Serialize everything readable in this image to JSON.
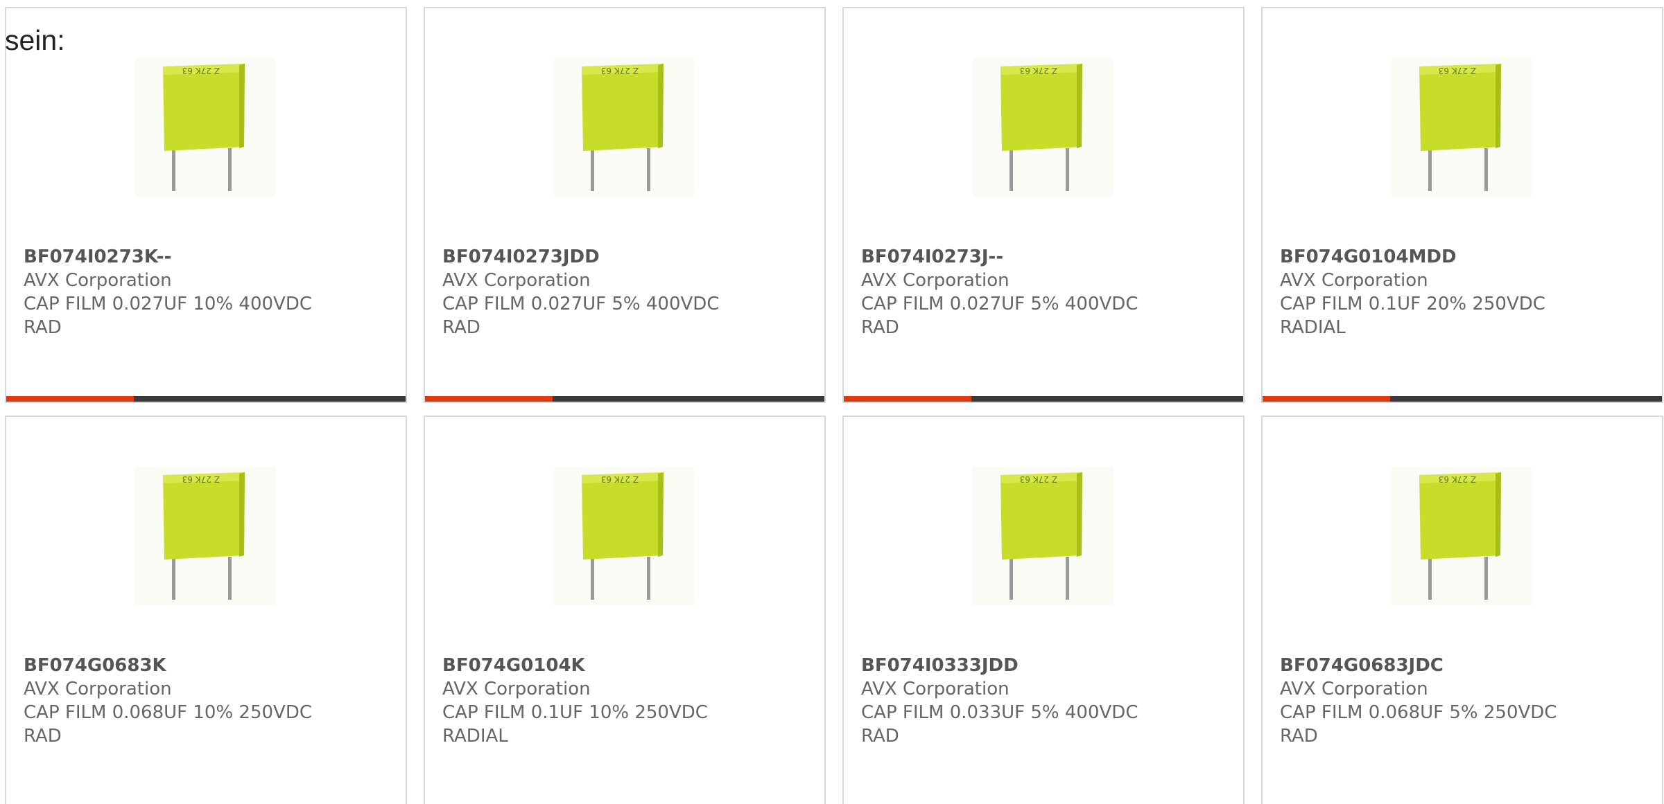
{
  "intro_text": "sein:",
  "colors": {
    "accent": "#e23a10",
    "bar": "#3a3a3a",
    "capacitor_body": "#c7dd2a"
  },
  "products": [
    {
      "part_number": "BF074I0273K--",
      "manufacturer": "AVX Corporation",
      "description_line1": "CAP FILM 0.027UF 10% 400VDC",
      "description_line2": "RAD",
      "image_icon": "film-capacitor-image"
    },
    {
      "part_number": "BF074I0273JDD",
      "manufacturer": "AVX Corporation",
      "description_line1": "CAP FILM 0.027UF 5% 400VDC",
      "description_line2": "RAD",
      "image_icon": "film-capacitor-image"
    },
    {
      "part_number": "BF074I0273J--",
      "manufacturer": "AVX Corporation",
      "description_line1": "CAP FILM 0.027UF 5% 400VDC",
      "description_line2": "RAD",
      "image_icon": "film-capacitor-image"
    },
    {
      "part_number": "BF074G0104MDD",
      "manufacturer": "AVX Corporation",
      "description_line1": "CAP FILM 0.1UF 20% 250VDC",
      "description_line2": "RADIAL",
      "image_icon": "film-capacitor-image"
    },
    {
      "part_number": "BF074G0683K",
      "manufacturer": "AVX Corporation",
      "description_line1": "CAP FILM 0.068UF 10% 250VDC",
      "description_line2": "RAD",
      "image_icon": "film-capacitor-image"
    },
    {
      "part_number": "BF074G0104K",
      "manufacturer": "AVX Corporation",
      "description_line1": "CAP FILM 0.1UF 10% 250VDC",
      "description_line2": "RADIAL",
      "image_icon": "film-capacitor-image"
    },
    {
      "part_number": "BF074I0333JDD",
      "manufacturer": "AVX Corporation",
      "description_line1": "CAP FILM 0.033UF 5% 400VDC",
      "description_line2": "RAD",
      "image_icon": "film-capacitor-image"
    },
    {
      "part_number": "BF074G0683JDC",
      "manufacturer": "AVX Corporation",
      "description_line1": "CAP FILM 0.068UF 5% 250VDC",
      "description_line2": "RAD",
      "image_icon": "film-capacitor-image"
    }
  ]
}
